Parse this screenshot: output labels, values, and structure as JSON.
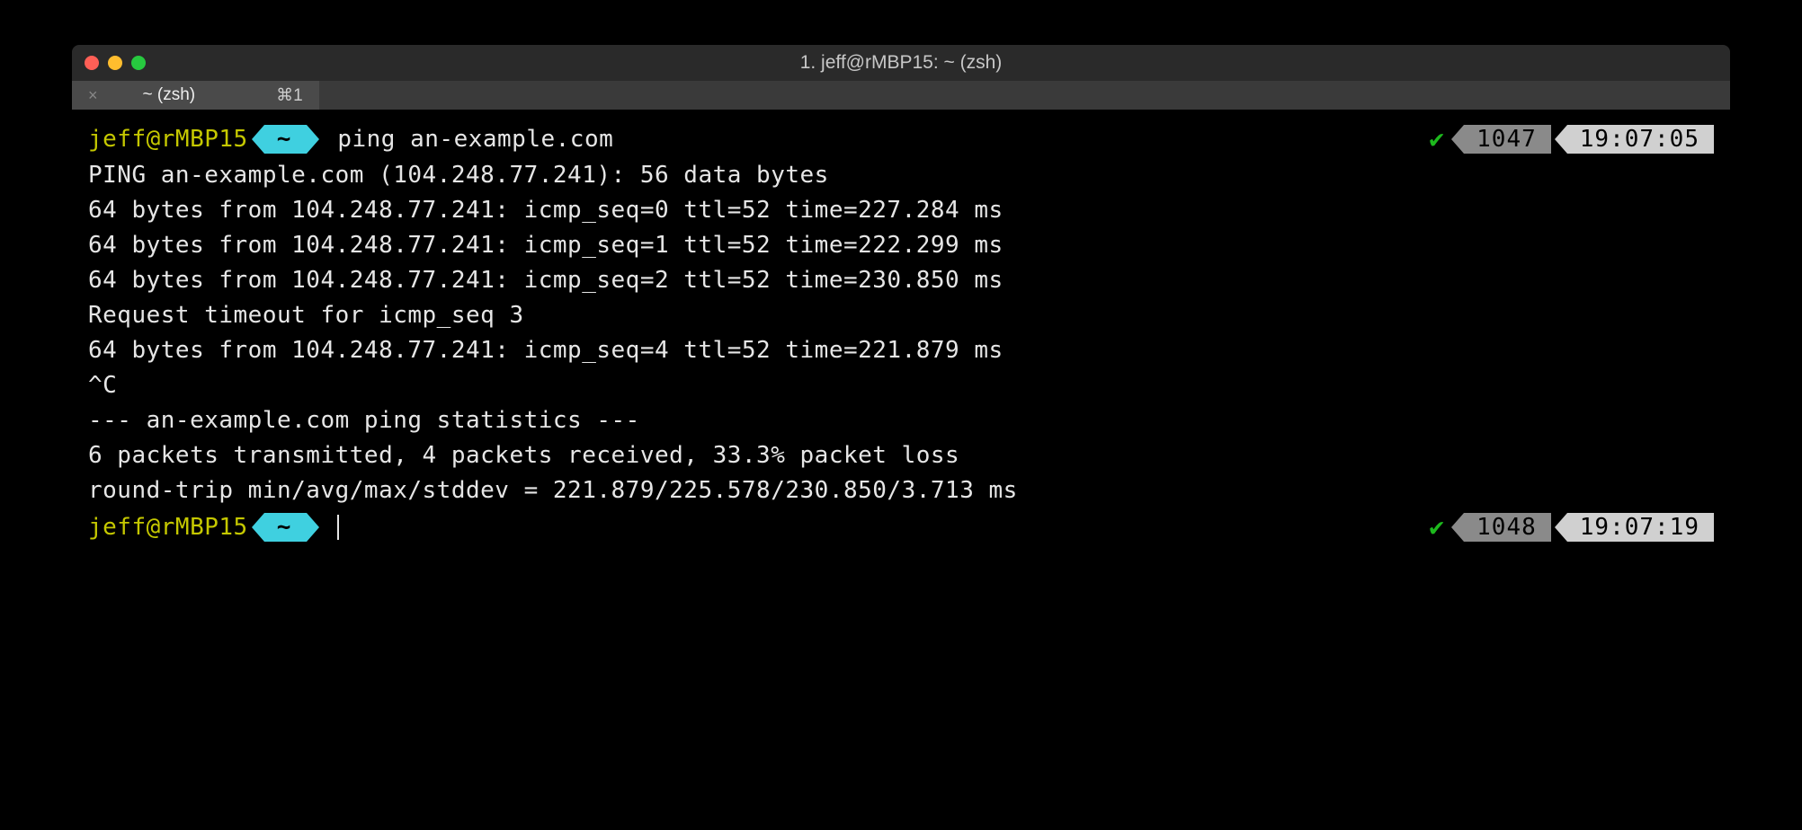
{
  "window": {
    "title": "1. jeff@rMBP15: ~ (zsh)"
  },
  "tab": {
    "label": "~ (zsh)",
    "shortcut": "⌘1",
    "close_glyph": "×"
  },
  "prompt1": {
    "user_host": "jeff@rMBP15",
    "cwd": "~",
    "command": "ping an-example.com",
    "check": "✔",
    "history_num": "1047",
    "time": "19:07:05"
  },
  "output": [
    "PING an-example.com (104.248.77.241): 56 data bytes",
    "64 bytes from 104.248.77.241: icmp_seq=0 ttl=52 time=227.284 ms",
    "64 bytes from 104.248.77.241: icmp_seq=1 ttl=52 time=222.299 ms",
    "64 bytes from 104.248.77.241: icmp_seq=2 ttl=52 time=230.850 ms",
    "Request timeout for icmp_seq 3",
    "64 bytes from 104.248.77.241: icmp_seq=4 ttl=52 time=221.879 ms",
    "^C",
    "--- an-example.com ping statistics ---",
    "6 packets transmitted, 4 packets received, 33.3% packet loss",
    "round-trip min/avg/max/stddev = 221.879/225.578/230.850/3.713 ms"
  ],
  "prompt2": {
    "user_host": "jeff@rMBP15",
    "cwd": "~",
    "check": "✔",
    "history_num": "1048",
    "time": "19:07:19"
  }
}
